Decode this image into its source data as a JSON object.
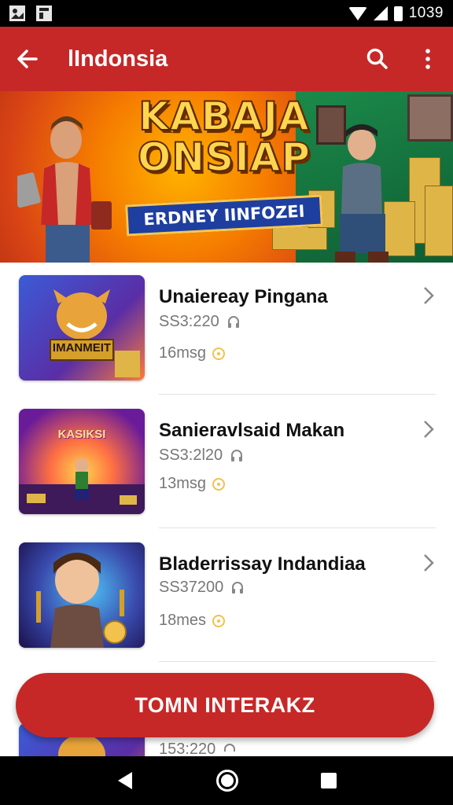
{
  "status_bar": {
    "time": "1039",
    "icons": [
      "image-icon",
      "notification-icon",
      "wifi-icon",
      "signal-icon",
      "battery-icon"
    ]
  },
  "app_bar": {
    "title": "lIndonsia",
    "back_icon": "arrow-left-icon",
    "search_icon": "search-icon",
    "menu_icon": "more-vert-icon",
    "color": "#c62828"
  },
  "banner": {
    "title_line1": "KABAJA",
    "title_line2": "ONSIAP",
    "ribbon": "ERDNEY IINFOZEI"
  },
  "items": [
    {
      "title": "Unaiereay Pingana",
      "price": "SS3:220",
      "count": "16msg",
      "thumb_label": "IMANMEIT"
    },
    {
      "title": "Sanieravlsaid Makan",
      "price": "SS3:2l20",
      "count": "13msg",
      "thumb_label": "KASIKSI"
    },
    {
      "title": "Bladerrissay Indandiaa",
      "price": "SS37200",
      "count": "18mes",
      "thumb_label": ""
    },
    {
      "title": "",
      "price": "153:220",
      "count": "",
      "thumb_label": ""
    }
  ],
  "cta": {
    "label": "TOMN INTERAKZ",
    "color": "#c62828"
  },
  "nav_bar": {
    "icons": [
      "back-triangle-icon",
      "home-circle-icon",
      "recents-square-icon"
    ]
  }
}
